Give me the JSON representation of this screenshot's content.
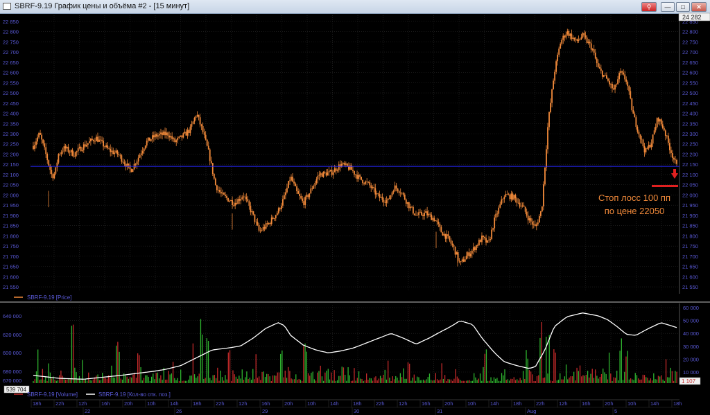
{
  "window": {
    "title": "SBRF-9.19 График цены и объёма #2 - [15 минут]",
    "icons": [
      "app-icon",
      "pin-icon",
      "minimize-icon",
      "maximize-icon",
      "close-icon"
    ]
  },
  "price_panel": {
    "legend": "SBRF-9.19 [Price]",
    "last_value": "24 282",
    "hline_level": 22140
  },
  "volume_panel": {
    "legend_volume": "SBRF-9.19 [Volume]",
    "legend_oi": "SBRF-9.19 [Кол-во отк. поз.]",
    "last_volume": "1 107",
    "cursor_value": "539 704"
  },
  "annotation": {
    "line1": "Стоп лосс 100 пп",
    "line2": "по цене 22050"
  },
  "colors": {
    "candle": "#f28a3a",
    "hline": "#2828ff",
    "vol_up": "#2fb52f",
    "vol_down": "#c42a2a",
    "oi": "#ffffff",
    "axis_text": "#5a5ad8"
  },
  "time_axis": {
    "top_labels": [
      "18h",
      "22h",
      "12h",
      "16h",
      "20h",
      "10h",
      "14h",
      "18h",
      "22h",
      "12h",
      "16h",
      "20h",
      "10h",
      "14h",
      "18h",
      "22h",
      "12h",
      "16h",
      "20h",
      "10h",
      "14h",
      "18h",
      "22h",
      "12h",
      "16h",
      "20h",
      "10h",
      "14h",
      "18h"
    ],
    "bottom_labels": [
      "22",
      "26",
      "29",
      "30",
      "31",
      "Aug",
      "5"
    ]
  },
  "chart_data": [
    {
      "type": "candlestick",
      "series_name": "SBRF-9.19 [Price]",
      "ylim": [
        21530,
        22880
      ],
      "y_ticks": [
        "22 850",
        "22 800",
        "22 750",
        "22 700",
        "22 650",
        "22 600",
        "22 550",
        "22 500",
        "22 450",
        "22 400",
        "22 350",
        "22 300",
        "22 250",
        "22 200",
        "22 150",
        "22 100",
        "22 050",
        "22 000",
        "21 950",
        "21 900",
        "21 850",
        "21 800",
        "21 750",
        "21 700",
        "21 650",
        "21 600",
        "21 550"
      ],
      "path": [
        [
          0,
          22240
        ],
        [
          2,
          22300
        ],
        [
          4,
          22200
        ],
        [
          6,
          22090
        ],
        [
          7,
          22110
        ],
        [
          8,
          22200
        ],
        [
          10,
          22230
        ],
        [
          13,
          22200
        ],
        [
          16,
          22240
        ],
        [
          20,
          22280
        ],
        [
          24,
          22220
        ],
        [
          27,
          22200
        ],
        [
          29,
          22160
        ],
        [
          31,
          22120
        ],
        [
          33,
          22170
        ],
        [
          36,
          22260
        ],
        [
          39,
          22290
        ],
        [
          43,
          22300
        ],
        [
          45,
          22260
        ],
        [
          47,
          22280
        ],
        [
          50,
          22320
        ],
        [
          52,
          22400
        ],
        [
          54,
          22310
        ],
        [
          56,
          22200
        ],
        [
          58,
          22050
        ],
        [
          60,
          22000
        ],
        [
          62,
          21980
        ],
        [
          64,
          21960
        ],
        [
          67,
          22000
        ],
        [
          70,
          21900
        ],
        [
          72,
          21820
        ],
        [
          75,
          21860
        ],
        [
          78,
          21920
        ],
        [
          80,
          21990
        ],
        [
          82,
          22090
        ],
        [
          84,
          22010
        ],
        [
          86,
          21960
        ],
        [
          88,
          22010
        ],
        [
          91,
          22100
        ],
        [
          95,
          22110
        ],
        [
          98,
          22150
        ],
        [
          101,
          22130
        ],
        [
          104,
          22080
        ],
        [
          107,
          22050
        ],
        [
          110,
          21990
        ],
        [
          113,
          21970
        ],
        [
          115,
          22040
        ],
        [
          117,
          22020
        ],
        [
          120,
          21940
        ],
        [
          122,
          21900
        ],
        [
          125,
          21910
        ],
        [
          128,
          21880
        ],
        [
          130,
          21820
        ],
        [
          132,
          21790
        ],
        [
          134,
          21740
        ],
        [
          136,
          21660
        ],
        [
          138,
          21700
        ],
        [
          140,
          21730
        ],
        [
          143,
          21790
        ],
        [
          145,
          21760
        ],
        [
          147,
          21880
        ],
        [
          150,
          22000
        ],
        [
          153,
          21990
        ],
        [
          156,
          21940
        ],
        [
          158,
          21880
        ],
        [
          160,
          21840
        ],
        [
          162,
          21930
        ],
        [
          164,
          22350
        ],
        [
          166,
          22600
        ],
        [
          168,
          22750
        ],
        [
          170,
          22800
        ],
        [
          173,
          22750
        ],
        [
          175,
          22780
        ],
        [
          178,
          22720
        ],
        [
          180,
          22620
        ],
        [
          183,
          22560
        ],
        [
          185,
          22510
        ],
        [
          187,
          22600
        ],
        [
          189,
          22560
        ],
        [
          191,
          22400
        ],
        [
          193,
          22300
        ],
        [
          195,
          22210
        ],
        [
          197,
          22260
        ],
        [
          199,
          22380
        ],
        [
          201,
          22320
        ],
        [
          203,
          22220
        ],
        [
          205,
          22140
        ]
      ]
    },
    {
      "type": "bar",
      "series_name": "SBRF-9.19 [Volume]",
      "note": "green bars up, red bars down; tall spikes near session starts"
    },
    {
      "type": "line",
      "series_name": "SBRF-9.19 [Кол-во отк. поз.]",
      "y_right_ticks": [
        "60 000",
        "50 000",
        "40 000",
        "30 000",
        "20 000",
        "10 000"
      ],
      "y_left_ticks": [
        "640 000",
        "620 000",
        "600 000",
        "680 000",
        "670 000"
      ],
      "path": [
        [
          0,
          674000
        ],
        [
          8,
          671000
        ],
        [
          16,
          670000
        ],
        [
          22,
          672000
        ],
        [
          28,
          674000
        ],
        [
          33,
          676000
        ],
        [
          38,
          678000
        ],
        [
          42,
          680000
        ],
        [
          47,
          684000
        ],
        [
          52,
          692000
        ],
        [
          57,
          700000
        ],
        [
          62,
          702000
        ],
        [
          66,
          704000
        ],
        [
          70,
          712000
        ],
        [
          74,
          722000
        ],
        [
          78,
          728000
        ],
        [
          80,
          725000
        ],
        [
          82,
          715000
        ],
        [
          86,
          705000
        ],
        [
          90,
          700000
        ],
        [
          94,
          697000
        ],
        [
          98,
          699000
        ],
        [
          102,
          702000
        ],
        [
          106,
          707000
        ],
        [
          110,
          712000
        ],
        [
          114,
          717000
        ],
        [
          118,
          712000
        ],
        [
          122,
          706000
        ],
        [
          126,
          712000
        ],
        [
          130,
          719000
        ],
        [
          133,
          724000
        ],
        [
          136,
          730000
        ],
        [
          140,
          726000
        ],
        [
          143,
          712000
        ],
        [
          147,
          697000
        ],
        [
          150,
          688000
        ],
        [
          154,
          684000
        ],
        [
          158,
          681000
        ],
        [
          160,
          683000
        ],
        [
          163,
          700000
        ],
        [
          166,
          724000
        ],
        [
          170,
          734000
        ],
        [
          175,
          738000
        ],
        [
          180,
          735000
        ],
        [
          183,
          731000
        ],
        [
          186,
          724000
        ],
        [
          189,
          716000
        ],
        [
          192,
          715000
        ],
        [
          196,
          722000
        ],
        [
          200,
          728000
        ],
        [
          205,
          723000
        ]
      ]
    }
  ]
}
